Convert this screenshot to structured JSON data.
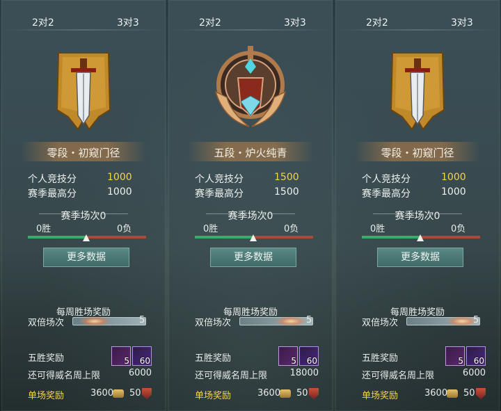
{
  "panels": [
    {
      "tabs": [
        "2对2",
        "3对3"
      ],
      "emblem": "banner-sword-icon",
      "rank_name": "零段・初窥门径",
      "score_label": "个人竞技分",
      "score_value": "1000",
      "best_label": "赛季最高分",
      "best_value": "1000",
      "season_title": "赛季场次0",
      "wins": "0胜",
      "losses": "0负",
      "more_button": "更多数据",
      "weekly_title": "每周胜场奖励",
      "double_label": "双倍场次",
      "double_count": "5",
      "fivewin_label": "五胜奖励",
      "chest_count": "5",
      "key_count": "60",
      "limit_label": "还可得威名周上限",
      "limit_value": "6000",
      "single_label": "单场奖励",
      "coin_value": "3600",
      "honor_value": "50"
    },
    {
      "tabs": [
        "2对2",
        "3对3"
      ],
      "emblem": "winged-sword-emblem-icon",
      "rank_name": "五段・炉火纯青",
      "score_label": "个人竞技分",
      "score_value": "1500",
      "best_label": "赛季最高分",
      "best_value": "1500",
      "season_title": "赛季场次0",
      "wins": "0胜",
      "losses": "0负",
      "more_button": "更多数据",
      "weekly_title": "每周胜场奖励",
      "double_label": "双倍场次",
      "double_count": "5",
      "fivewin_label": "五胜奖励",
      "chest_count": "5",
      "key_count": "60",
      "limit_label": "还可得威名周上限",
      "limit_value": "18000",
      "single_label": "单场奖励",
      "coin_value": "3600",
      "honor_value": "50"
    },
    {
      "tabs": [
        "2对2",
        "3对3"
      ],
      "emblem": "banner-sword-icon",
      "rank_name": "零段・初窥门径",
      "score_label": "个人竞技分",
      "score_value": "1000",
      "best_label": "赛季最高分",
      "best_value": "1000",
      "season_title": "赛季场次0",
      "wins": "0胜",
      "losses": "0负",
      "more_button": "更多数据",
      "weekly_title": "每周胜场奖励",
      "double_label": "双倍场次",
      "double_count": "5",
      "fivewin_label": "五胜奖励",
      "chest_count": "5",
      "key_count": "60",
      "limit_label": "还可得威名周上限",
      "limit_value": "6000",
      "single_label": "单场奖励",
      "coin_value": "3600",
      "honor_value": "50"
    }
  ],
  "colors": {
    "gold_text": "#f5d54a",
    "win_bar": "#3fa96a",
    "loss_bar": "#a84b3c",
    "button": "#4f7c79"
  }
}
